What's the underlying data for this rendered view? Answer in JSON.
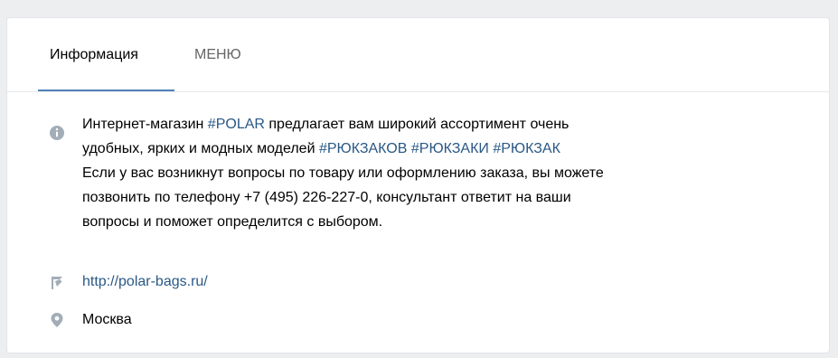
{
  "tabs": [
    {
      "label": "Информация"
    },
    {
      "label": "МЕНЮ"
    }
  ],
  "description": {
    "line1": {
      "pre": "Интернет-магазин ",
      "tag": "#POLAR",
      "post": " предлагает вам широкий ассортимент очень"
    },
    "line2": {
      "pre": "удобных, ярких и модных моделей ",
      "tag1": "#РЮКЗАКОВ",
      "tag2": "#РЮКЗАКИ",
      "tag3": "#РЮКЗАК"
    },
    "line3": "Если у вас возникнут вопросы по товару или оформлению заказа, вы можете",
    "line4": "позвонить по телефону +7 (495) 226-227-0, консультант ответит на ваши",
    "line5": "вопросы и поможет определится с выбором."
  },
  "website": "http://polar-bags.ru/",
  "city": "Москва",
  "icons": {
    "info": "info-icon",
    "link": "link-arrow-icon",
    "location": "location-pin-icon"
  },
  "colors": {
    "accent": "#5181b8",
    "link": "#2a5885",
    "icon": "#a3adb8"
  }
}
